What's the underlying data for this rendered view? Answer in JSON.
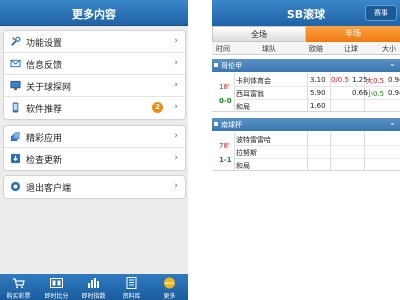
{
  "left": {
    "title": "更多内容",
    "group1": [
      {
        "label": "功能设置",
        "icon": "wrench-icon"
      },
      {
        "label": "信息反馈",
        "icon": "envelope-icon"
      },
      {
        "label": "关于球探网",
        "icon": "monitor-icon"
      },
      {
        "label": "软件推荐",
        "icon": "phone-icon",
        "badge": "2"
      }
    ],
    "group2": [
      {
        "label": "精彩应用",
        "icon": "apps-icon"
      },
      {
        "label": "检查更新",
        "icon": "update-icon"
      }
    ],
    "group3": [
      {
        "label": "退出客户端",
        "icon": "exit-icon"
      }
    ],
    "arrow": "›",
    "tabs": [
      {
        "label": "购买彩票",
        "icon": "cart-icon"
      },
      {
        "label": "即时比分",
        "icon": "scoreboard-icon"
      },
      {
        "label": "即时指数",
        "icon": "bars-icon"
      },
      {
        "label": "资料库",
        "icon": "book-icon"
      },
      {
        "label": "更多",
        "icon": "more-icon"
      }
    ]
  },
  "right": {
    "title": "SB滚球",
    "events_button": "赛事",
    "segments": [
      "全场",
      "半场"
    ],
    "columns": [
      "时间",
      "球队",
      "欧赔",
      "让球",
      "大小"
    ],
    "leagues": [
      {
        "name": "哥伦甲",
        "minute": "18'",
        "score": "0-0",
        "rows": [
          {
            "team": "卡利体育会",
            "odds": "3.10",
            "handicap_line": "0/0.5",
            "handicap_odds": "1.25",
            "ou_line": "大0.5",
            "ou_odds": "0.94"
          },
          {
            "team": "西耳富翁",
            "odds": "5.90",
            "handicap_line": "",
            "handicap_odds": "0.66",
            "ou_line": "小0.5",
            "ou_odds": "0.94"
          },
          {
            "team": "和局",
            "odds": "1.60",
            "handicap_line": "",
            "handicap_odds": "",
            "ou_line": "",
            "ou_odds": ""
          }
        ]
      },
      {
        "name": "南球杯",
        "minute": "78'",
        "score": "1-1",
        "rows": [
          {
            "team": "波特雷雷哈",
            "odds": ""
          },
          {
            "team": "拉努斯",
            "odds": ""
          },
          {
            "team": "和局",
            "odds": ""
          }
        ]
      }
    ]
  },
  "colors": {
    "header_blue": "#2b74b8",
    "accent_orange": "#f28a1e",
    "live_red": "#d02020",
    "score_green": "#1b8a1b"
  }
}
